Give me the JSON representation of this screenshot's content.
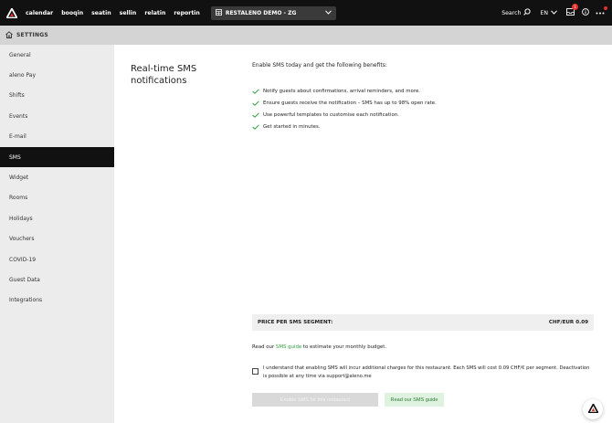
{
  "topbar": {
    "nav": [
      "calendar",
      "booqin",
      "seatin",
      "sellin",
      "relatin",
      "reportin"
    ],
    "restaurant": "RESTALENO DEMO - ZG",
    "search_label": "Search",
    "language": "EN",
    "notification_count": "1"
  },
  "settings_bar": {
    "label": "SETTINGS"
  },
  "sidebar": {
    "items": [
      "General",
      "aleno Pay",
      "Shifts",
      "Events",
      "E-mail",
      "SMS",
      "Widget",
      "Rooms",
      "Holidays",
      "Vouchers",
      "COVID-19",
      "Guest Data",
      "Integrations"
    ],
    "active_index": 5
  },
  "main": {
    "heading": "Real-time SMS notifications",
    "intro": "Enable SMS today and get the following benefits:",
    "benefits": [
      "Notify guests about confirmations, arrival reminders, and more.",
      "Ensure guests receive the notification – SMS has up to 98% open rate.",
      "Use powerful templates to customise each notification.",
      "Get started in minutes."
    ],
    "price_label": "PRICE PER SMS SEGMENT:",
    "price_value": "CHF/EUR 0.09",
    "budget_prefix": "Read our ",
    "budget_link": "SMS guide",
    "budget_suffix": " to estimate your monthly budget.",
    "consent": "I understand that enabling SMS will incur additional charges for this restaurant. Each SMS will cost 0.09 CHF/€ per segment. Deactivation is possible at any time via support@aleno.me",
    "enable_button": "Enable SMS for this restaurant",
    "guide_button": "Read our SMS guide"
  },
  "colors": {
    "accent_green": "#2e9e3a",
    "topbar": "#111111",
    "badge_red": "#e5322d"
  }
}
